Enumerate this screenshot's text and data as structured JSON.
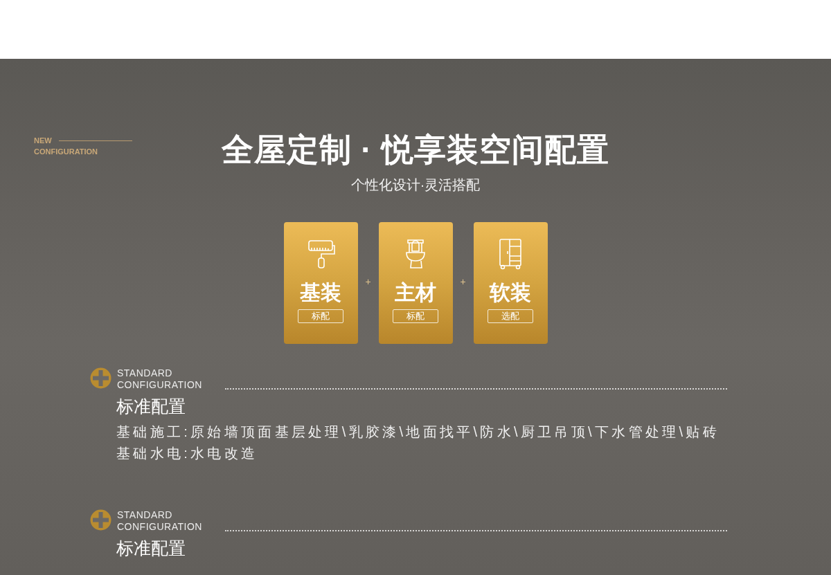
{
  "header": {
    "tag_lines": [
      "NEW",
      "CONFIGURATION"
    ],
    "title": "全屋定制 · 悦享装空间配置",
    "subtitle": "个性化设计·灵活搭配"
  },
  "packages": [
    {
      "kind": "roller",
      "name": "基装",
      "badge": "标配"
    },
    {
      "kind": "toilet",
      "name": "主材",
      "badge": "标配"
    },
    {
      "kind": "cabinet",
      "name": "软装",
      "badge": "选配"
    }
  ],
  "separators": [
    "+",
    "+"
  ],
  "sections": [
    {
      "label_lines": [
        "STANDARD",
        "CONFIGURATION"
      ],
      "title": "标准配置",
      "lines": [
        "基础施工:原始墙顶面基层处理\\乳胶漆\\地面找平\\防水\\厨卫吊顶\\下水管处理\\贴砖",
        "基础水电:水电改造"
      ]
    },
    {
      "label_lines": [
        "STANDARD",
        "CONFIGURATION"
      ],
      "title": "标准配置"
    }
  ]
}
